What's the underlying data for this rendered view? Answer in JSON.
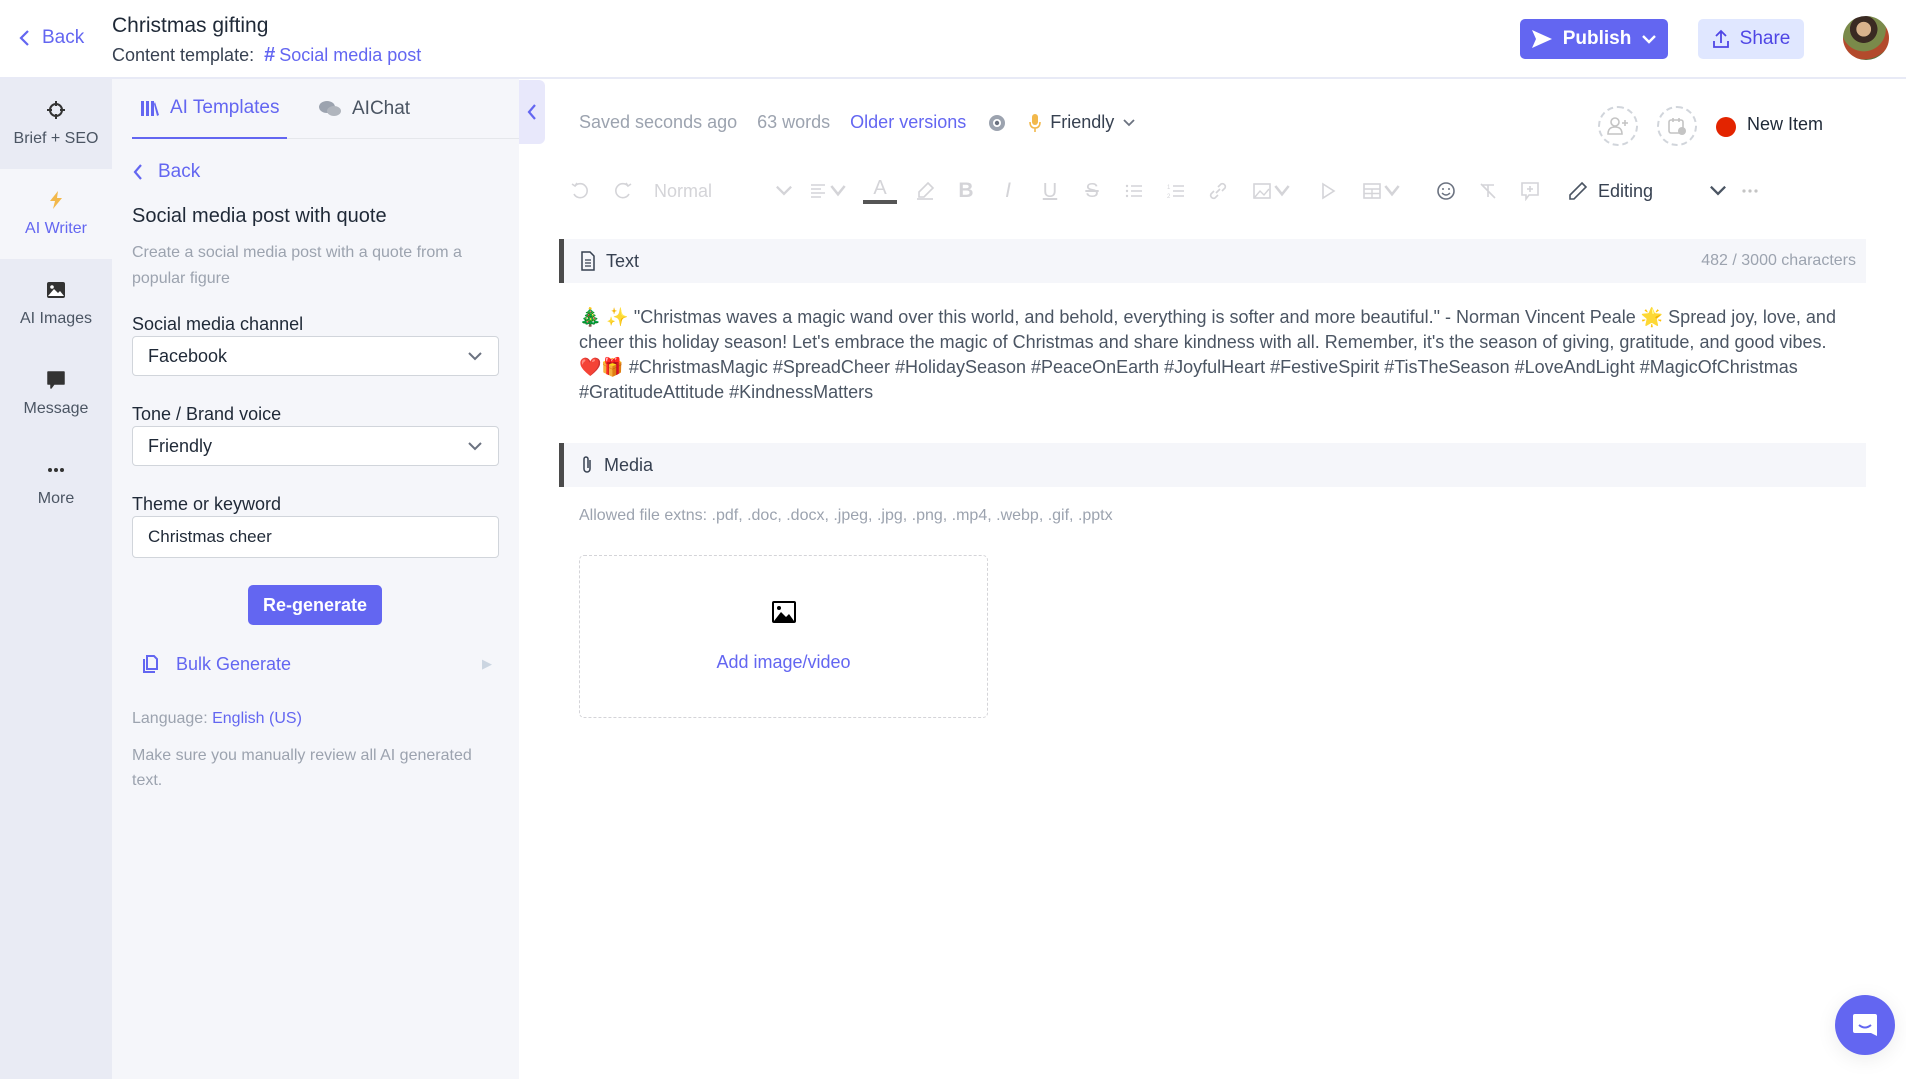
{
  "header": {
    "back_label": "Back",
    "title": "Christmas gifting",
    "template_prefix": "Content template:",
    "template_name": "Social media post",
    "publish_label": "Publish",
    "share_label": "Share"
  },
  "rail": {
    "items": [
      {
        "label": "Brief + SEO",
        "icon": "crosshair-icon"
      },
      {
        "label": "AI Writer",
        "icon": "lightning-icon",
        "active": true
      },
      {
        "label": "AI Images",
        "icon": "image-icon"
      },
      {
        "label": "Message",
        "icon": "chat-bubble-icon"
      },
      {
        "label": "More",
        "icon": "more-dots-icon"
      }
    ]
  },
  "panel": {
    "tabs": [
      {
        "label": "AI Templates",
        "active": true
      },
      {
        "label": "AIChat",
        "active": false
      }
    ],
    "back_label": "Back",
    "template_title": "Social media post with quote",
    "template_desc": "Create a social media post with a quote from a popular figure",
    "fields": {
      "channel": {
        "label": "Social media channel",
        "value": "Facebook"
      },
      "tone": {
        "label": "Tone / Brand voice",
        "value": "Friendly"
      },
      "theme": {
        "label": "Theme or keyword",
        "value": "Christmas cheer"
      }
    },
    "regenerate_label": "Re-generate",
    "bulk_label": "Bulk Generate",
    "language_prefix": "Language:",
    "language_value": "English (US)",
    "note": "Make sure you manually review all AI generated text."
  },
  "editor": {
    "saved_status": "Saved seconds ago",
    "word_count": "63 words",
    "older_versions": "Older versions",
    "tone": "Friendly",
    "status_label": "New Item",
    "status_color": "#e32400",
    "toolbar": {
      "style_select": "Normal",
      "mode_label": "Editing"
    },
    "text_section": {
      "label": "Text",
      "char_count": "482 / 3000 characters",
      "content": "🎄 ✨ \"Christmas waves a magic wand over this world, and behold, everything is softer and more beautiful.\" - Norman Vincent Peale 🌟 Spread joy, love, and cheer this holiday season! Let's embrace the magic of Christmas and share kindness with all. Remember, it's the season of giving, gratitude, and good vibes. ❤️🎁 #ChristmasMagic #SpreadCheer #HolidaySeason #PeaceOnEarth #JoyfulHeart #FestiveSpirit #TisTheSeason #LoveAndLight #MagicOfChristmas #GratitudeAttitude #KindnessMatters"
    },
    "media_section": {
      "label": "Media",
      "allowed": "Allowed file extns: .pdf, .doc, .docx, .jpeg, .jpg, .png, .mp4, .webp, .gif, .pptx",
      "add_label": "Add image/video"
    }
  },
  "colors": {
    "accent": "#6366f1",
    "accent_light": "#e0e7ff",
    "rail_bg": "#e9ebf4",
    "panel_bg": "#f5f6fa"
  }
}
